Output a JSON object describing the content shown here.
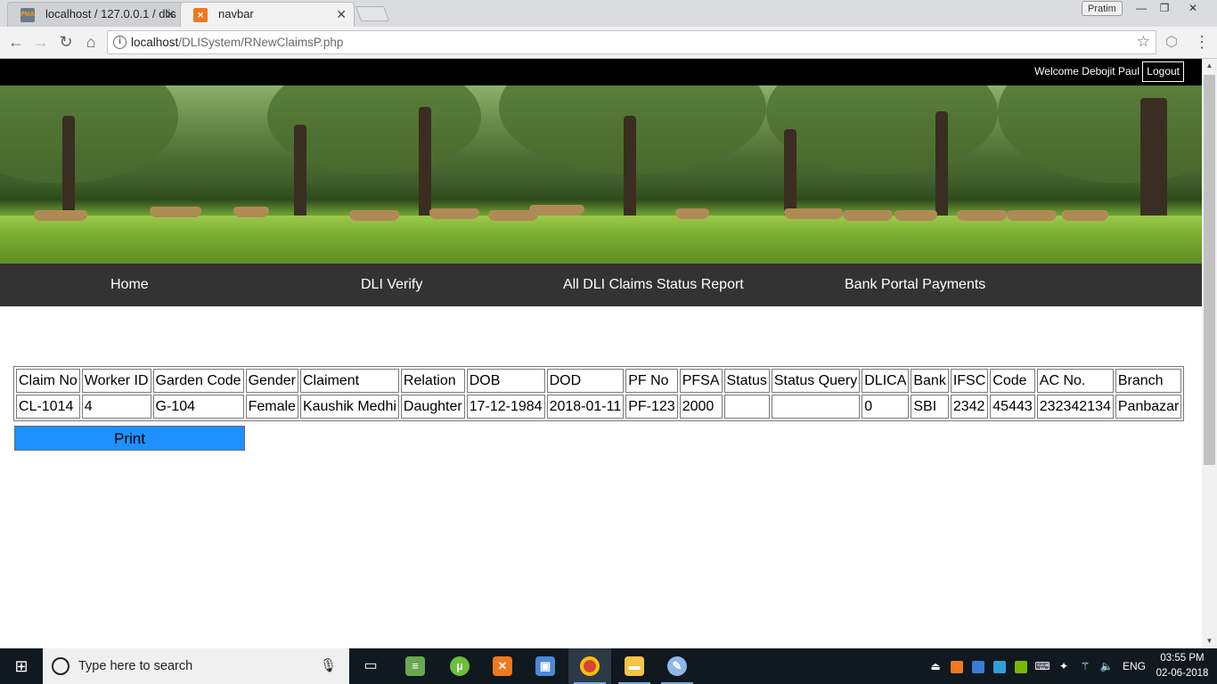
{
  "browser": {
    "tabs": [
      {
        "title": "localhost / 127.0.0.1 / dlis",
        "favicon": "phpmyadmin-icon"
      },
      {
        "title": "navbar",
        "favicon": "xampp-icon"
      }
    ],
    "profile_name": "Pratim",
    "url_host": "localhost",
    "url_path": "/DLISystem/RNewClaimsP.php"
  },
  "page": {
    "welcome_text": "Welcome Debojit Paul",
    "logout_label": "Logout",
    "nav": {
      "home": "Home",
      "dli_verify": "DLI Verify",
      "claims_report": "All DLI Claims Status Report",
      "bank_portal": "Bank Portal Payments"
    },
    "table": {
      "headers": [
        "Claim No",
        "Worker ID",
        "Garden Code",
        "Gender",
        "Claiment",
        "Relation",
        "DOB",
        "DOD",
        "PF No",
        "PFSA",
        "Status",
        "Status Query",
        "DLICA",
        "Bank",
        "IFSC",
        "Code",
        "AC No.",
        "Branch"
      ],
      "rows": [
        [
          "CL-1014",
          "4",
          "G-104",
          "Female",
          "Kaushik Medhi",
          "Daughter",
          "17-12-1984",
          "2018-01-11",
          "PF-123",
          "2000",
          "",
          "",
          "0",
          "SBI",
          "2342",
          "45443",
          "232342134",
          "Panbazar"
        ]
      ]
    },
    "print_label": "Print",
    "colors": {
      "print_button": "#1e90ff",
      "nav_bar": "#333333",
      "top_bar": "#000000"
    }
  },
  "taskbar": {
    "search_placeholder": "Type here to search",
    "language": "ENG",
    "time": "03:55 PM",
    "date": "02-06-2018"
  }
}
